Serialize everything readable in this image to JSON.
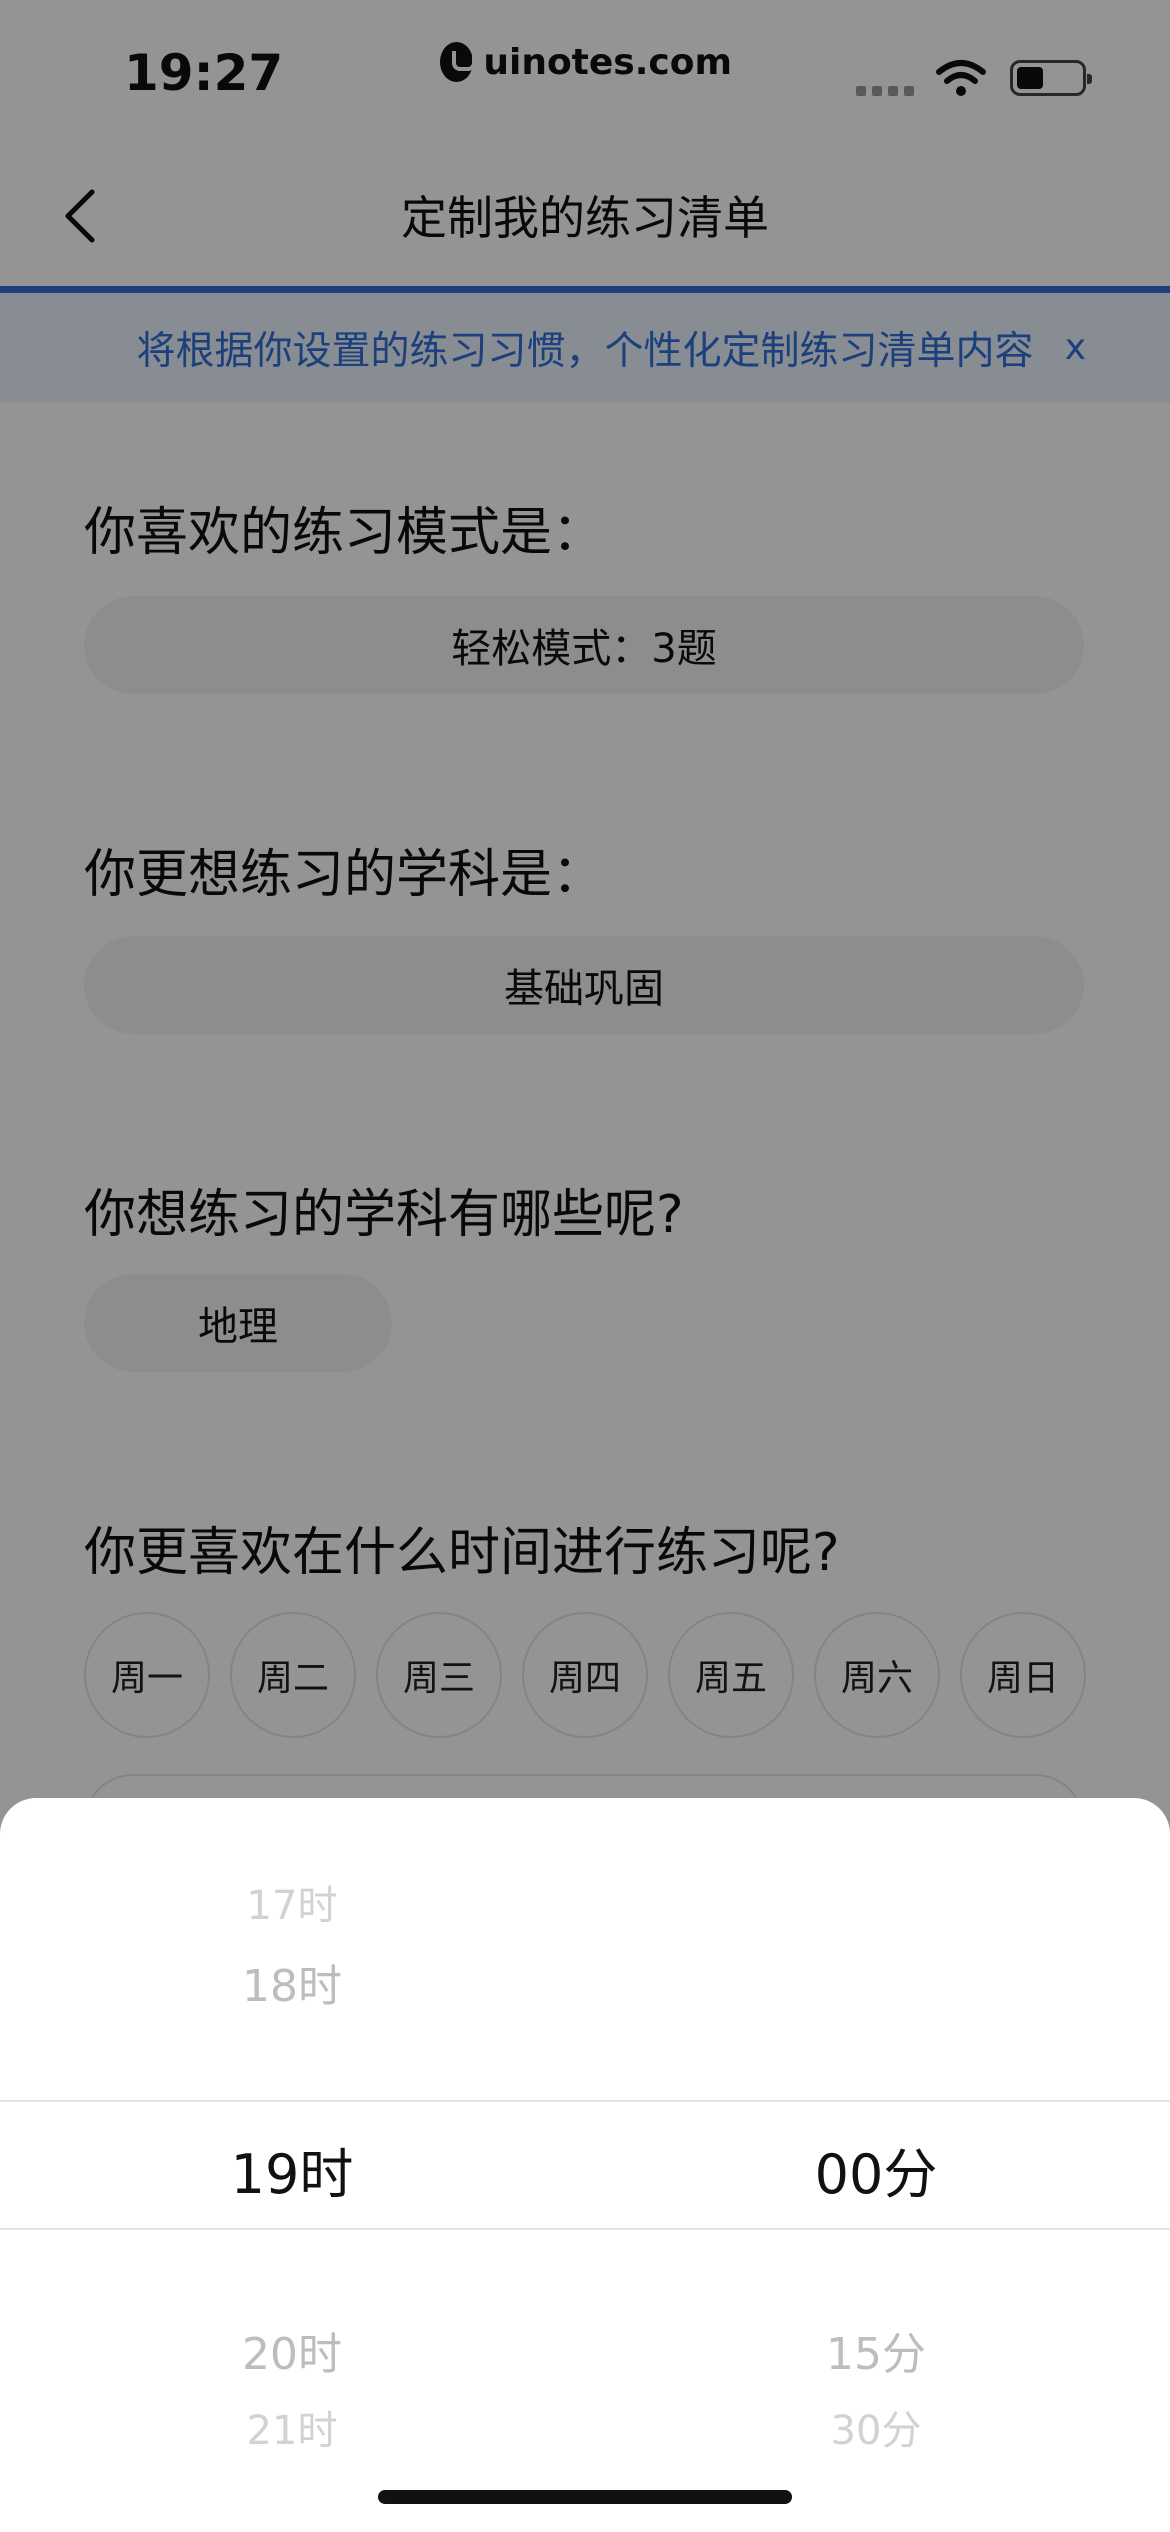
{
  "status_bar": {
    "time": "19:27",
    "url": "uinotes.com",
    "icons": [
      "signal-icon",
      "wifi-icon",
      "battery-icon"
    ]
  },
  "nav": {
    "back_icon": "chevron-left-icon",
    "title": "定制我的练习清单"
  },
  "notice": {
    "text": "将根据你设置的练习习惯，个性化定制练习清单内容",
    "close": "x"
  },
  "questions": {
    "mode": {
      "label": "你喜欢的练习模式是：",
      "value": "轻松模式：3题"
    },
    "focus": {
      "label": "你更想练习的学科是：",
      "value": "基础巩固"
    },
    "subjects": {
      "label": "你想练习的学科有哪些呢?",
      "chips": [
        "地理"
      ]
    },
    "schedule": {
      "label": "你更喜欢在什么时间进行练习呢?",
      "weekdays": [
        "周一",
        "周二",
        "周三",
        "周四",
        "周五",
        "周六",
        "周日"
      ]
    }
  },
  "picker": {
    "hours": [
      "17时",
      "18时",
      "19时",
      "20时",
      "21时"
    ],
    "minutes": [
      "00分",
      "15分",
      "30分"
    ],
    "selected_hour": "19时",
    "selected_minute": "00分"
  },
  "colors": {
    "accent": "#2f6fd6",
    "notice_bg": "#eaf2fd",
    "pill_bg": "#f1f3f7",
    "overlay": "rgba(0,0,0,0.42)"
  }
}
